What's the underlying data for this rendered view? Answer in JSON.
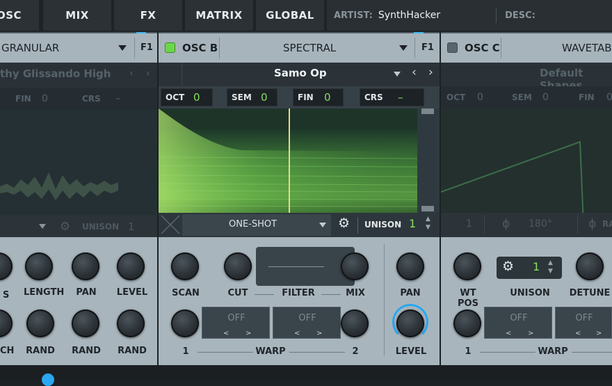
{
  "tabs": {
    "osc": "OSC",
    "mix": "MIX",
    "fx": "FX",
    "matrix": "MATRIX",
    "global": "GLOBAL"
  },
  "info": {
    "artist_label": "ARTIST:",
    "artist_value": "SynthHacker",
    "desc_label": "DESC:"
  },
  "left": {
    "type": "GRANULAR",
    "filter": "F1",
    "preset": "thy Glissando High",
    "fin": "FIN",
    "fin_val": "0",
    "crs": "CRS",
    "crs_val": "–",
    "unison": "UNISON",
    "unison_val": "1",
    "knobs_top": [
      "S",
      "LENGTH",
      "PAN",
      "LEVEL"
    ],
    "knobs_bottom": [
      "CH",
      "RAND",
      "RAND",
      "RAND"
    ]
  },
  "mid": {
    "name": "OSC B",
    "type": "SPECTRAL",
    "filter": "F1",
    "preset": "Samo Op",
    "oct": "OCT",
    "oct_val": "0",
    "sem": "SEM",
    "sem_val": "0",
    "fin": "FIN",
    "fin_val": "0",
    "crs": "CRS",
    "crs_val": "–",
    "mode": "ONE-SHOT",
    "unison": "UNISON",
    "unison_val": "1",
    "scan": "SCAN",
    "cut": "CUT",
    "filter_label": "FILTER",
    "mix": "MIX",
    "pan": "PAN",
    "level": "LEVEL",
    "warp_off1": "OFF",
    "warp_off2": "OFF",
    "warp_one": "1",
    "warp_label": "WARP",
    "warp_two": "2"
  },
  "right": {
    "name": "OSC C",
    "type": "WAVETABL",
    "preset": "Default Shapes",
    "sem": "SEM",
    "sem_val": "0",
    "fin": "FIN",
    "fin_val": "0",
    "phase_val": "180°",
    "rand": "RA",
    "unison_count": "1",
    "wtpos": "WT POS",
    "unison": "UNISON",
    "detune": "DETUNE",
    "warp_off1": "OFF",
    "warp_off2": "OFF",
    "warp_one": "1",
    "warp_label": "WARP",
    "one_left": "1",
    "oct_val": "0"
  },
  "colors": {
    "accent": "#4cc3ff",
    "green": "#7ed95a"
  }
}
